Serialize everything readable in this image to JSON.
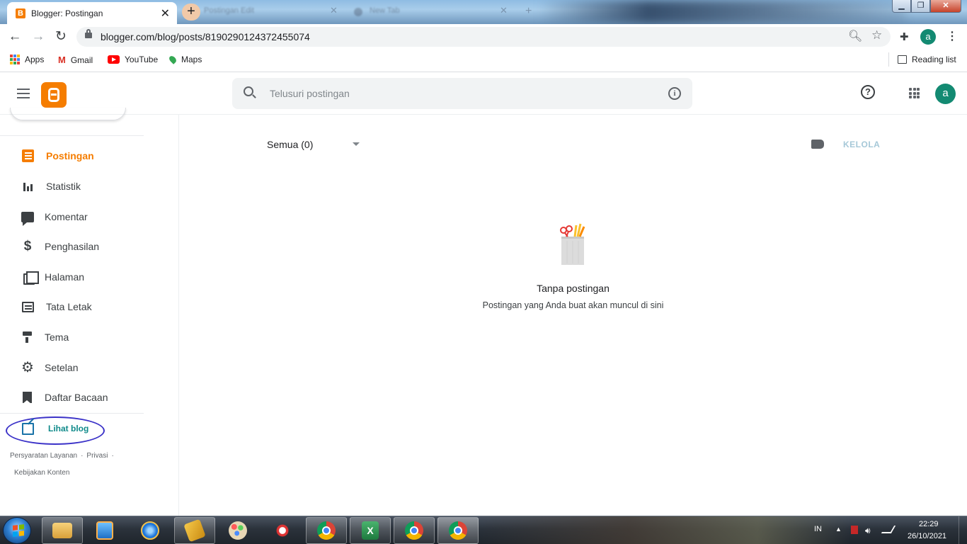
{
  "browser": {
    "active_tab": {
      "title": "Blogger: Postingan"
    },
    "background_tabs": [
      "Postingan Edit",
      "New Tab"
    ],
    "new_tab_symbol": "+",
    "close_symbol": "✕",
    "url": "blogger.com/blog/posts/8190290124372455074",
    "profile_initial": "a",
    "bookmarks": [
      {
        "label": "Apps",
        "icon": "apps-grid-icon"
      },
      {
        "label": "Gmail",
        "icon": "gmail-icon"
      },
      {
        "label": "YouTube",
        "icon": "youtube-icon"
      },
      {
        "label": "Maps",
        "icon": "maps-icon"
      }
    ],
    "reading_list_label": "Reading list"
  },
  "app": {
    "search_placeholder": "Telusuri postingan",
    "profile_initial": "a",
    "brand_color": "#f57d00"
  },
  "sidebar": {
    "items": [
      {
        "label": "Postingan",
        "icon": "posts-icon",
        "active": true
      },
      {
        "label": "Statistik",
        "icon": "stats-icon"
      },
      {
        "label": "Komentar",
        "icon": "comment-icon"
      },
      {
        "label": "Penghasilan",
        "icon": "dollar-icon"
      },
      {
        "label": "Halaman",
        "icon": "pages-icon"
      },
      {
        "label": "Tata Letak",
        "icon": "layout-icon"
      },
      {
        "label": "Tema",
        "icon": "theme-icon"
      },
      {
        "label": "Setelan",
        "icon": "settings-icon"
      },
      {
        "label": "Daftar Bacaan",
        "icon": "bookmark-icon"
      }
    ],
    "view_blog_label": "Lihat blog",
    "footer": {
      "terms": "Persyaratan Layanan",
      "privacy": "Privasi",
      "content_policy": "Kebijakan Konten"
    }
  },
  "main": {
    "filter_label": "Semua (0)",
    "manage_label": "KELOLA",
    "empty_title": "Tanpa postingan",
    "empty_subtitle": "Postingan yang Anda buat akan muncul di sini"
  },
  "taskbar": {
    "language": "IN",
    "time": "22:29",
    "date": "26/10/2021",
    "pinned": [
      "explorer-icon",
      "media-player-icon",
      "internet-explorer-icon",
      "winamp-icon",
      "paint-icon",
      "snipping-tool-icon",
      "chrome-icon",
      "excel-icon",
      "chrome-icon",
      "chrome-icon"
    ]
  }
}
